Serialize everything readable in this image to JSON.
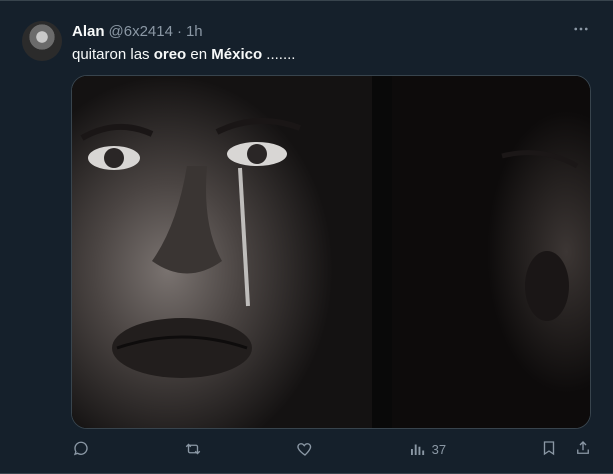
{
  "tweet": {
    "author": {
      "name": "Alan",
      "handle": "@6x2414"
    },
    "meta": {
      "separator": "·",
      "time": "1h"
    },
    "text": {
      "part1": "quitaron las ",
      "bold1": "oreo",
      "part2": " en ",
      "bold2": "México",
      "part3": " ......."
    },
    "actions": {
      "views_count": "37"
    },
    "icons": {
      "more": "more-options-icon",
      "reply": "reply-icon",
      "retweet": "retweet-icon",
      "like": "like-icon",
      "views": "views-icon",
      "bookmark": "bookmark-icon",
      "share": "share-icon"
    },
    "colors": {
      "background": "#15202b",
      "text": "#f7f9f9",
      "muted": "#8b98a5",
      "border": "#38444d"
    }
  }
}
